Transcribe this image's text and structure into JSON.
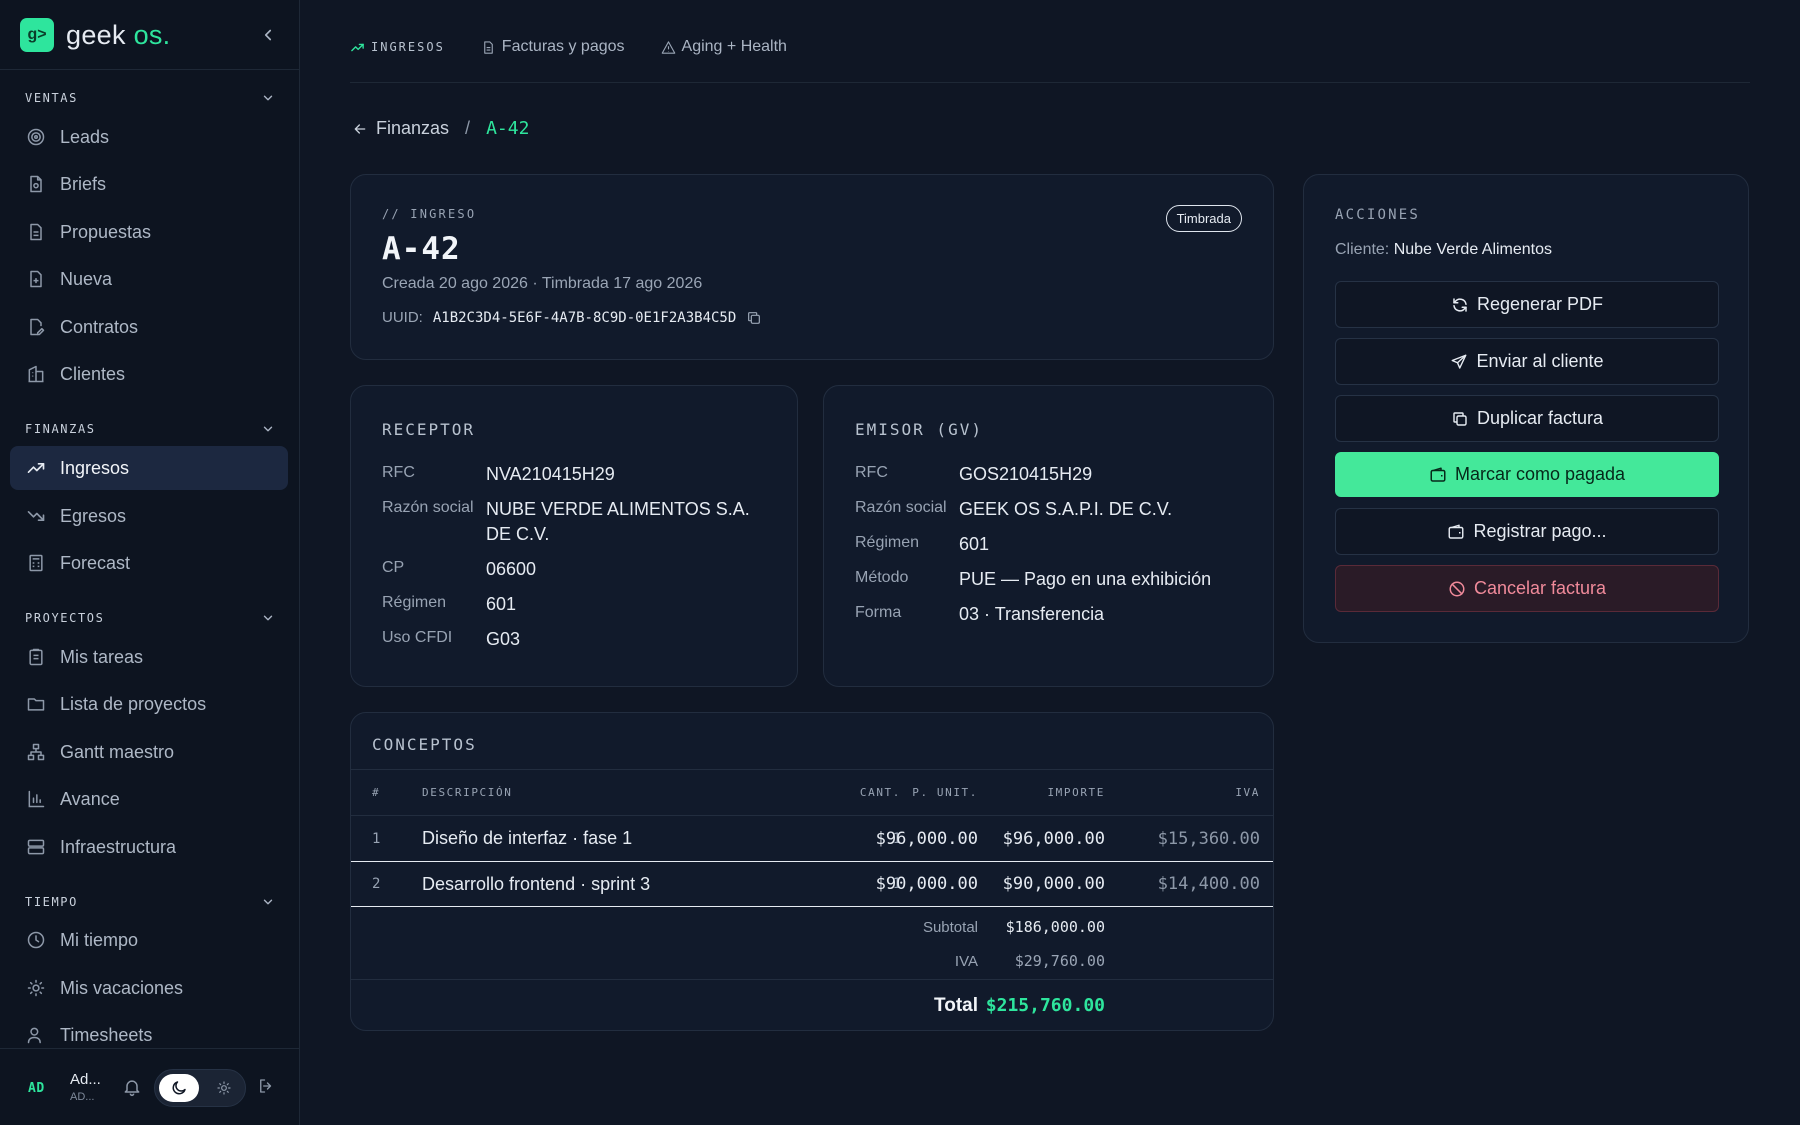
{
  "brand": {
    "logo_glyph": "g>",
    "name": "geek",
    "name_suffix": "os."
  },
  "sidebar": {
    "sections": {
      "ventas": "VENTAS",
      "finanzas": "FINANZAS",
      "proyectos": "PROYECTOS",
      "tiempo": "TIEMPO"
    },
    "items": {
      "leads": {
        "label": "Leads",
        "icon": "target-icon"
      },
      "briefs": {
        "label": "Briefs",
        "icon": "document-icon"
      },
      "propuestas": {
        "label": "Propuestas",
        "icon": "file-text-icon"
      },
      "nueva": {
        "label": "Nueva",
        "icon": "file-plus-icon"
      },
      "contratos": {
        "label": "Contratos",
        "icon": "file-pen-icon"
      },
      "clientes": {
        "label": "Clientes",
        "icon": "building-icon"
      },
      "ingresos": {
        "label": "Ingresos",
        "icon": "trending-up-icon",
        "active": true
      },
      "egresos": {
        "label": "Egresos",
        "icon": "trending-down-icon"
      },
      "forecast": {
        "label": "Forecast",
        "icon": "calculator-icon"
      },
      "mis_tareas": {
        "label": "Mis tareas",
        "icon": "clipboard-icon"
      },
      "lista_proyectos": {
        "label": "Lista de proyectos",
        "icon": "folder-icon"
      },
      "gantt": {
        "label": "Gantt maestro",
        "icon": "hierarchy-icon"
      },
      "avance": {
        "label": "Avance",
        "icon": "bar-chart-icon"
      },
      "infraestructura": {
        "label": "Infraestructura",
        "icon": "server-icon"
      },
      "mi_tiempo": {
        "label": "Mi tiempo",
        "icon": "clock-icon"
      },
      "vacaciones": {
        "label": "Mis vacaciones",
        "icon": "sun-icon"
      },
      "timesheets": {
        "label": "Timesheets",
        "icon": "users-icon"
      }
    },
    "user": {
      "initials": "AD",
      "name": "Ad...",
      "sub": "AD..."
    }
  },
  "tabs": [
    {
      "label": "INGRESOS",
      "icon": "trending-up-icon",
      "active": true
    },
    {
      "label": "Facturas y pagos",
      "icon": "file-icon"
    },
    {
      "label": "Aging + Health",
      "icon": "warning-icon"
    }
  ],
  "breadcrumb": {
    "parent": "Finanzas",
    "separator": "/",
    "current": "A-42"
  },
  "invoice": {
    "eyebrow": "// INGRESO",
    "title": "A-42",
    "dates": "Creada 20 ago 2026 · Timbrada 17 ago 2026",
    "uuid_label": "UUID:",
    "uuid": "A1B2C3D4-5E6F-4A7B-8C9D-0E1F2A3B4C5D",
    "status": "Timbrada"
  },
  "receptor": {
    "title": "RECEPTOR",
    "rows": [
      {
        "label": "RFC",
        "value": "NVA210415H29"
      },
      {
        "label": "Razón social",
        "value": "NUBE VERDE ALIMENTOS S.A. DE C.V."
      },
      {
        "label": "CP",
        "value": "06600"
      },
      {
        "label": "Régimen",
        "value": "601"
      },
      {
        "label": "Uso CFDI",
        "value": "G03"
      }
    ]
  },
  "emisor": {
    "title": "EMISOR (GV)",
    "rows": [
      {
        "label": "RFC",
        "value": "GOS210415H29"
      },
      {
        "label": "Razón social",
        "value": "GEEK OS S.A.P.I. DE C.V."
      },
      {
        "label": "Régimen",
        "value": "601"
      },
      {
        "label": "Método",
        "value": "PUE — Pago en una exhibición"
      },
      {
        "label": "Forma",
        "value": "03 · Transferencia"
      }
    ]
  },
  "conceptos": {
    "title": "CONCEPTOS",
    "headers": {
      "num": "#",
      "desc": "DESCRIPCIÓN",
      "cant": "CANT.",
      "punit": "P. UNIT.",
      "importe": "IMPORTE",
      "iva": "IVA"
    },
    "rows": [
      {
        "num": "1",
        "desc": "Diseño de interfaz · fase 1",
        "cant": "1",
        "punit": "$96,000.00",
        "importe": "$96,000.00",
        "iva": "$15,360.00"
      },
      {
        "num": "2",
        "desc": "Desarrollo frontend · sprint 3",
        "cant": "1",
        "punit": "$90,000.00",
        "importe": "$90,000.00",
        "iva": "$14,400.00"
      }
    ],
    "subtotal_label": "Subtotal",
    "subtotal": "$186,000.00",
    "iva_label": "IVA",
    "iva": "$29,760.00",
    "total_label": "Total",
    "total": "$215,760.00"
  },
  "actions": {
    "title": "ACCIONES",
    "client_label": "Cliente:",
    "client_name": "Nube Verde Alimentos",
    "buttons": {
      "regenerar": "Regenerar PDF",
      "enviar": "Enviar al cliente",
      "duplicar": "Duplicar factura",
      "pagada": "Marcar como pagada",
      "registrar": "Registrar pago...",
      "cancelar": "Cancelar factura"
    }
  },
  "colors": {
    "accent": "#2ee59d",
    "background": "#0f1624",
    "card": "#111a2b",
    "danger": "#f08a9a"
  }
}
